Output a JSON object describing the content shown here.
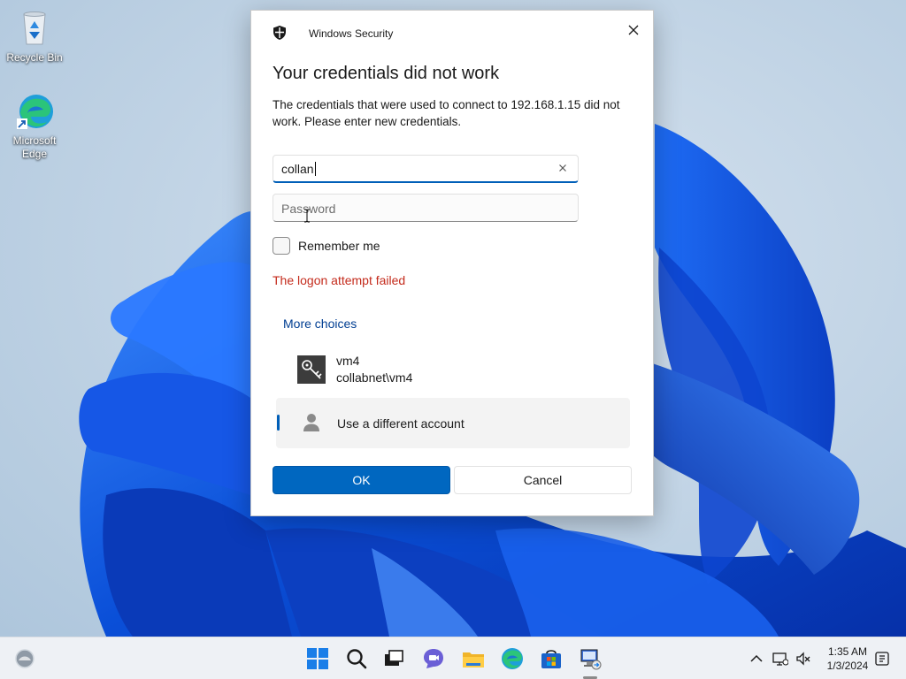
{
  "desktop": {
    "icons": [
      {
        "label": "Recycle Bin"
      },
      {
        "label": "Microsoft Edge"
      }
    ]
  },
  "dialog": {
    "app_title": "Windows Security",
    "heading": "Your credentials did not work",
    "message": "The credentials that were used to connect to 192.168.1.15 did not work. Please enter new credentials.",
    "username": {
      "value": "collan"
    },
    "password": {
      "placeholder": "Password"
    },
    "remember_label": "Remember me",
    "error": "The logon attempt failed",
    "more_choices": "More choices",
    "accounts": [
      {
        "name": "vm4",
        "domain": "collabnet\\vm4",
        "icon": "key-icon"
      },
      {
        "name": "Use a different account",
        "icon": "person-icon",
        "selected": true
      }
    ],
    "ok_label": "OK",
    "cancel_label": "Cancel"
  },
  "taskbar": {
    "pinned": [
      "start-icon",
      "search-icon",
      "task-view-icon",
      "chat-icon",
      "file-explorer-icon",
      "edge-icon",
      "store-icon",
      "remote-desktop-icon"
    ],
    "clock": {
      "time": "1:35 AM",
      "date": "1/3/2024"
    }
  },
  "colors": {
    "accent": "#0067c0",
    "error": "#c42b1c",
    "link": "#003e92"
  }
}
